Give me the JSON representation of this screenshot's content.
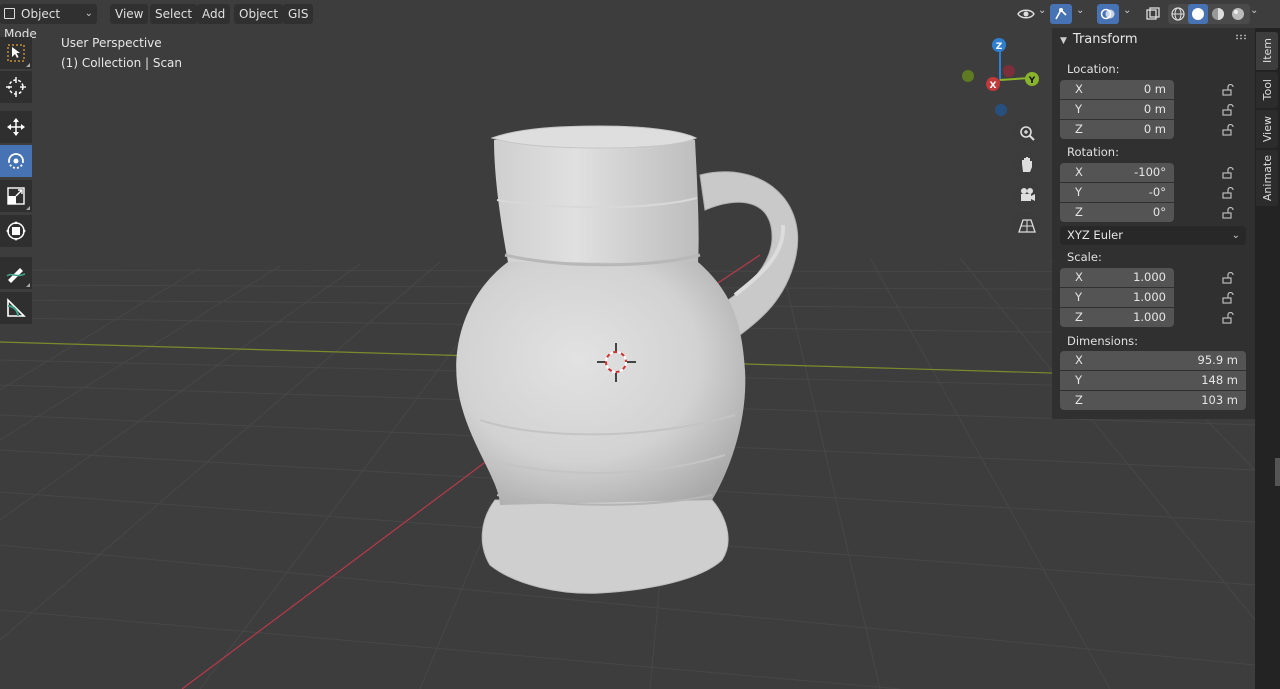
{
  "header": {
    "mode_label": "Object Mode",
    "menus": [
      "View",
      "Select",
      "Add",
      "Object",
      "GIS"
    ]
  },
  "overlay": {
    "view_name": "User Perspective",
    "collection": "(1) Collection | Scan"
  },
  "gizmo": {
    "x_label": "X",
    "y_label": "Y",
    "z_label": "Z"
  },
  "npanel": {
    "title": "Transform",
    "location": {
      "label": "Location:",
      "rows": [
        {
          "axis": "X",
          "value": "0 m"
        },
        {
          "axis": "Y",
          "value": "0 m"
        },
        {
          "axis": "Z",
          "value": "0 m"
        }
      ]
    },
    "rotation": {
      "label": "Rotation:",
      "rows": [
        {
          "axis": "X",
          "value": "-100°"
        },
        {
          "axis": "Y",
          "value": "-0°"
        },
        {
          "axis": "Z",
          "value": "0°"
        }
      ],
      "mode": "XYZ Euler"
    },
    "scale": {
      "label": "Scale:",
      "rows": [
        {
          "axis": "X",
          "value": "1.000"
        },
        {
          "axis": "Y",
          "value": "1.000"
        },
        {
          "axis": "Z",
          "value": "1.000"
        }
      ]
    },
    "dimensions": {
      "label": "Dimensions:",
      "rows": [
        {
          "axis": "X",
          "value": "95.9 m"
        },
        {
          "axis": "Y",
          "value": "148 m"
        },
        {
          "axis": "Z",
          "value": "103 m"
        }
      ]
    }
  },
  "tabs": [
    "Item",
    "Tool",
    "View",
    "Animate"
  ],
  "colors": {
    "accent": "#4772b3",
    "viewport_bg": "#3d3d3d",
    "x_axis": "#c0393b",
    "y_axis": "#8ab32c",
    "z_axis": "#2f7fd1"
  }
}
